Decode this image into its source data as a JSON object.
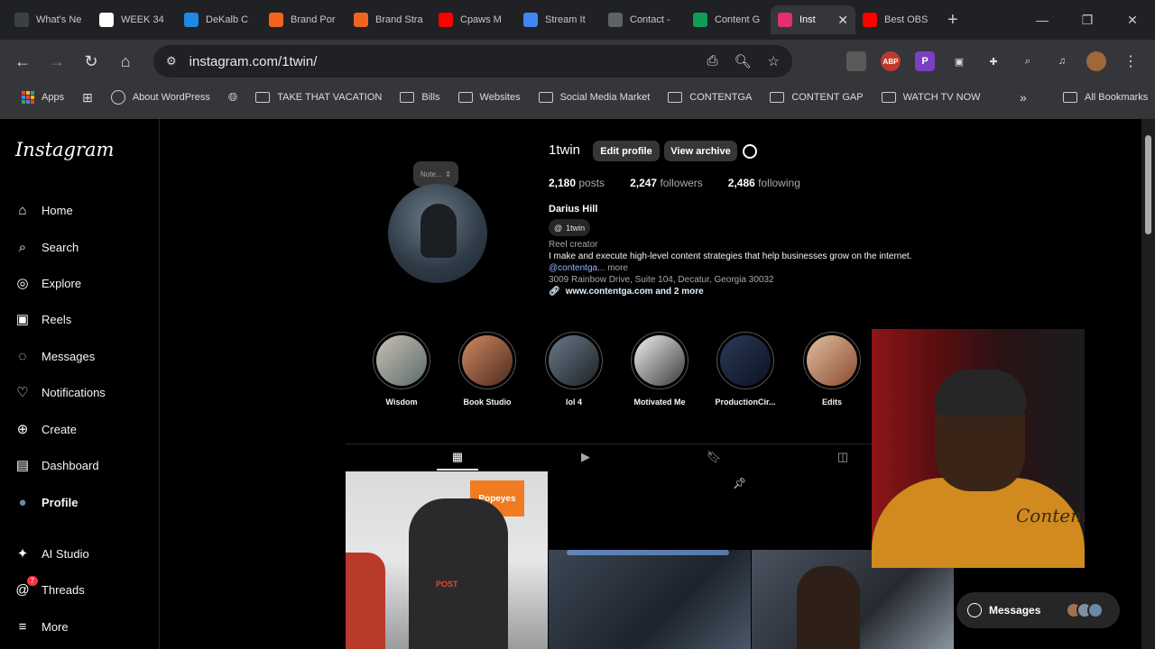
{
  "browser": {
    "tabs": [
      {
        "label": "What's Ne",
        "icon": "chrome-icon",
        "color": "#3c4043"
      },
      {
        "label": "WEEK 34",
        "icon": "notion-icon",
        "color": "#ffffff"
      },
      {
        "label": "DeKalb C",
        "icon": "dekalb-icon",
        "color": "#1e88e5"
      },
      {
        "label": "Brand Por",
        "icon": "etsy-icon",
        "color": "#f1641e"
      },
      {
        "label": "Brand Stra",
        "icon": "etsy-icon",
        "color": "#f1641e"
      },
      {
        "label": "Cpaws M",
        "icon": "youtube-icon",
        "color": "#ff0000"
      },
      {
        "label": "Stream It",
        "icon": "docs-icon",
        "color": "#4285f4"
      },
      {
        "label": "Contact -",
        "icon": "globe-icon",
        "color": "#5f6368"
      },
      {
        "label": "Content G",
        "icon": "sheets-icon",
        "color": "#0f9d58"
      },
      {
        "label": "Inst",
        "icon": "instagram-icon",
        "color": "#e1306c",
        "active": true
      },
      {
        "label": "Best OBS",
        "icon": "youtube-icon",
        "color": "#ff0000"
      }
    ],
    "url": "instagram.com/1twin/",
    "bookmarks": [
      "Apps",
      "About WordPress",
      "TAKE THAT VACATION",
      "Bills",
      "Websites",
      "Social Media Market",
      "CONTENTGA",
      "CONTENT GAP",
      "WATCH TV NOW"
    ],
    "all_bookmarks": "All Bookmarks",
    "ext_abp": "ABP",
    "ext_p": "P"
  },
  "sidebar": {
    "logo": "Instagram",
    "items": [
      {
        "label": "Home",
        "icon": "home-icon"
      },
      {
        "label": "Search",
        "icon": "search-icon"
      },
      {
        "label": "Explore",
        "icon": "explore-icon"
      },
      {
        "label": "Reels",
        "icon": "reels-icon"
      },
      {
        "label": "Messages",
        "icon": "messenger-icon"
      },
      {
        "label": "Notifications",
        "icon": "heart-icon"
      },
      {
        "label": "Create",
        "icon": "plus-icon"
      },
      {
        "label": "Dashboard",
        "icon": "dashboard-icon"
      },
      {
        "label": "Profile",
        "icon": "profile-avatar"
      },
      {
        "label": "AI Studio",
        "icon": "ai-studio-icon"
      },
      {
        "label": "Threads",
        "icon": "threads-icon",
        "badge": "7"
      },
      {
        "label": "More",
        "icon": "menu-icon"
      }
    ]
  },
  "profile": {
    "note_placeholder": "Note...",
    "username": "1twin",
    "edit_profile": "Edit profile",
    "view_archive": "View archive",
    "posts_count": "2,180",
    "posts_label": "posts",
    "followers_count": "2,247",
    "followers_label": "followers",
    "following_count": "2,486",
    "following_label": "following",
    "full_name": "Darius Hill",
    "threads_handle": "1twin",
    "category": "Reel creator",
    "bio": "I make and execute high-level content strategies that help businesses grow on the internet.",
    "mention": "@contentga",
    "more": "... more",
    "address": "3009 Rainbow Drive, Suite 104, Decatur, Georgia 30032",
    "link": "www.contentga.com and 2 more"
  },
  "highlights": [
    {
      "label": "Wisdom"
    },
    {
      "label": "Book Studio"
    },
    {
      "label": "lol 4"
    },
    {
      "label": "Motivated Me"
    },
    {
      "label": "ProductionCir..."
    },
    {
      "label": "Edits"
    }
  ],
  "post_text": "POST",
  "popeyes": "Popeyes",
  "messages_pill": "Messages",
  "overlay_text": "Content"
}
